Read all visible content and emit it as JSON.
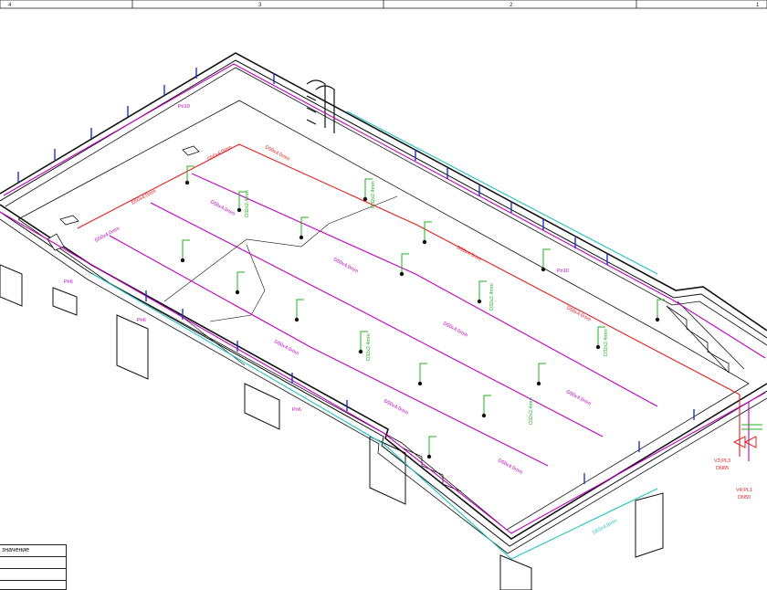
{
  "frame": {
    "zone_labels": [
      "4",
      "3",
      "2",
      "1"
    ]
  },
  "legend": {
    "header_text": "значение"
  },
  "annotations": {
    "pipe_long": "D50x4.0mm",
    "pipe_short": "D32x2.4mm",
    "pipe_supply": "D63x4.8mm",
    "nozzle": "Pn6",
    "nozzle_long": "Pn10",
    "valve_label_1": "V3;PL3",
    "valve_label_2": "V4;PL1",
    "valve_dn_1": "DN65",
    "valve_dn_2": "DN50"
  },
  "colors": {
    "pipe_return": "#c000c0",
    "pipe_supply": "#e02020",
    "pipe_inlet": "#20b020",
    "pipe_cyan": "#20c0c0",
    "pipe_blue": "#2030d0",
    "structure": "#111111"
  }
}
